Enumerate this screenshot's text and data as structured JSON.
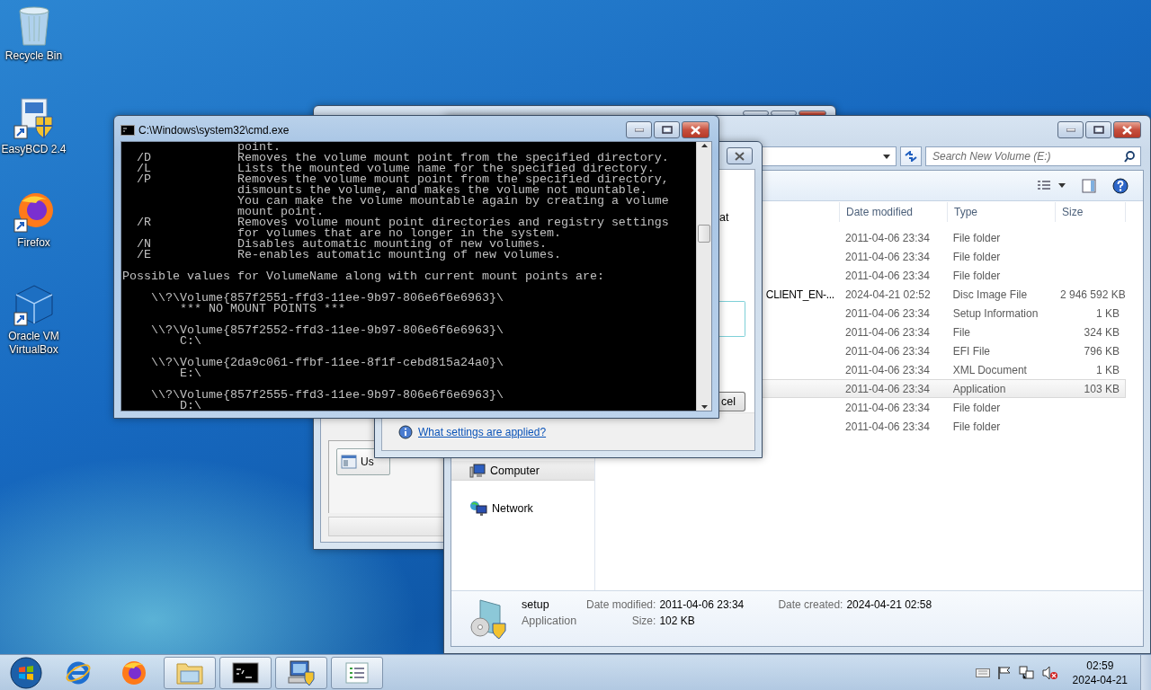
{
  "desktop_icons": [
    {
      "label": "Recycle Bin",
      "kind": "recycle"
    },
    {
      "label": "EasyBCD 2.4",
      "kind": "easybcd"
    },
    {
      "label": "Firefox",
      "kind": "firefox"
    },
    {
      "label": "Oracle VM VirtualBox",
      "kind": "virtualbox"
    }
  ],
  "back_window": {
    "list_item": "Us"
  },
  "explorer": {
    "search": {
      "placeholder": "Search New Volume (E:)"
    },
    "columns": [
      "Date modified",
      "Type",
      "Size"
    ],
    "rows": [
      {
        "date": "2011-04-06 23:34",
        "type": "File folder",
        "selected": false
      },
      {
        "date": "2011-04-06 23:34",
        "type": "File folder",
        "selected": false
      },
      {
        "date": "2011-04-06 23:34",
        "type": "File folder",
        "selected": false
      },
      {
        "name": "CLIENT_EN-...",
        "date": "2024-04-21 02:52",
        "type": "Disc Image File",
        "size": "2 946 592 KB",
        "selected": false
      },
      {
        "date": "2011-04-06 23:34",
        "type": "Setup Information",
        "size": "1 KB",
        "selected": false
      },
      {
        "date": "2011-04-06 23:34",
        "type": "File",
        "size": "324 KB",
        "selected": false
      },
      {
        "date": "2011-04-06 23:34",
        "type": "EFI File",
        "size": "796 KB",
        "selected": false
      },
      {
        "date": "2011-04-06 23:34",
        "type": "XML Document",
        "size": "1 KB",
        "selected": false
      },
      {
        "date": "2011-04-06 23:34",
        "type": "Application",
        "size": "103 KB",
        "selected": true
      },
      {
        "date": "2011-04-06 23:34",
        "type": "File folder",
        "selected": false
      },
      {
        "date": "2011-04-06 23:34",
        "type": "File folder",
        "selected": false
      }
    ],
    "nav_items": [
      {
        "label": "Computer",
        "kind": "computer",
        "selected": true
      },
      {
        "label": "Network",
        "kind": "network",
        "selected": false
      }
    ],
    "details": {
      "name": "setup",
      "type": "Application",
      "fields": [
        {
          "label": "Date modified:",
          "value": "2011-04-06 23:34"
        },
        {
          "label": "Date created:",
          "value": "2024-04-21 02:58"
        },
        {
          "label": "Size:",
          "value": "102 KB"
        }
      ]
    }
  },
  "dialog": {
    "partial_label": "at",
    "button": "cel",
    "link": "What settings are applied?"
  },
  "cmd": {
    "title": "C:\\Windows\\system32\\cmd.exe",
    "blocks": [
      [
        "                point.",
        "  /D            Removes the volume mount point from the specified directory.",
        "  /L            Lists the mounted volume name for the specified directory.",
        "  /P            Removes the volume mount point from the specified directory,",
        "                dismounts the volume, and makes the volume not mountable.",
        "                You can make the volume mountable again by creating a volume",
        "                mount point.",
        "  /R            Removes volume mount point directories and registry settings",
        "                for volumes that are no longer in the system.",
        "  /N            Disables automatic mounting of new volumes.",
        "  /E            Re-enables automatic mounting of new volumes."
      ],
      [
        "Possible values for VolumeName along with current mount points are:"
      ],
      [
        "    \\\\?\\Volume{857f2551-ffd3-11ee-9b97-806e6f6e6963}\\",
        "        *** NO MOUNT POINTS ***"
      ],
      [
        "    \\\\?\\Volume{857f2552-ffd3-11ee-9b97-806e6f6e6963}\\",
        "        C:\\"
      ],
      [
        "    \\\\?\\Volume{2da9c061-ffbf-11ee-8f1f-cebd815a24a0}\\",
        "        E:\\"
      ],
      [
        "    \\\\?\\Volume{857f2555-ffd3-11ee-9b97-806e6f6e6963}\\",
        "        D:\\"
      ]
    ]
  },
  "taskbar": {
    "apps": [
      {
        "kind": "ie",
        "open": false
      },
      {
        "kind": "firefox",
        "open": false
      },
      {
        "kind": "folder",
        "open": true
      },
      {
        "kind": "console",
        "open": true
      },
      {
        "kind": "network-setup",
        "open": true
      },
      {
        "kind": "list",
        "open": true
      }
    ],
    "tray": {
      "time": "02:59",
      "date": "2024-04-21"
    }
  }
}
